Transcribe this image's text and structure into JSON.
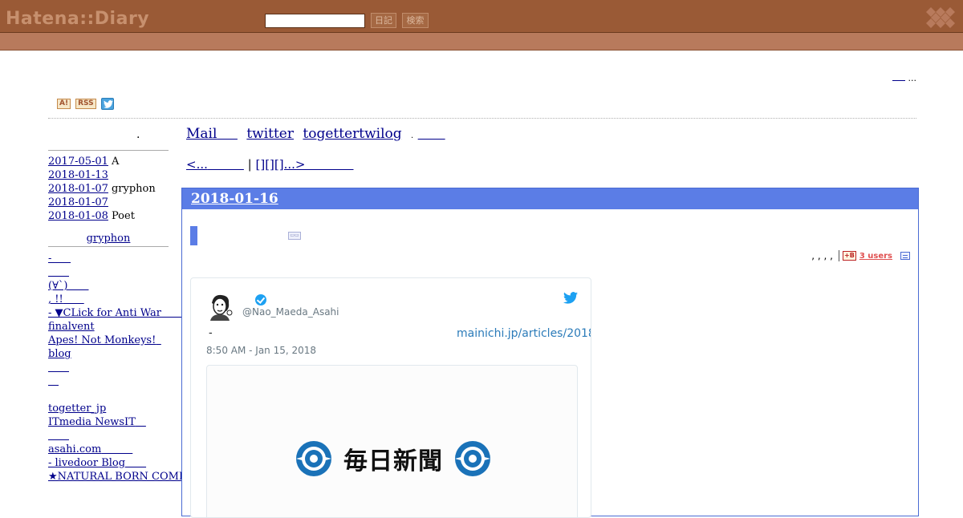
{
  "header": {
    "logo_text": "Hatena::Diary",
    "search_placeholder": "",
    "diary_button": "日記",
    "search_button": "検索"
  },
  "top_right": {
    "link": "",
    "dots": "..."
  },
  "badges": {
    "a": "A!",
    "rss": "RSS",
    "twitter": "twitter-icon"
  },
  "sidebar": {
    "dot": ".",
    "recent": [
      {
        "date": "2017-05-01",
        "text": "A"
      },
      {
        "date": "2018-01-13",
        "text": ""
      },
      {
        "date": "2018-01-07",
        "text": "gryphon"
      },
      {
        "date": "2018-01-07",
        "text": ""
      },
      {
        "date": "2018-01-08",
        "text": "Poet"
      }
    ],
    "title": "gryphon",
    "links": [
      "- ",
      "",
      "(∀`)",
      ", !!",
      " - ▼CLick for Anti War",
      "finalvent",
      "Apes! Not Monkeys!",
      "blog",
      "",
      "",
      "",
      "togetter_jp",
      "ITmedia NewsIT",
      "",
      "asahi.com",
      " - livedoor Blog",
      "★NATURAL BORN COMICS)"
    ]
  },
  "nav": {
    "mail": "Mail",
    "twitter": "twitter",
    "togetter": "togettertwilog",
    "dot": ".",
    "extra": ""
  },
  "pager": {
    "prev": "<...",
    "sep": "|",
    "next": "[][][]...>"
  },
  "day": {
    "date": "2018-01-16",
    "commas": ", , , ,",
    "hatebu_icon": "+B",
    "users": "3 users"
  },
  "tweet": {
    "handle": "@Nao_Maeda_Asahi",
    "dash": "-",
    "link": "mainichi.jp/articles/2018",
    "time": "8:50 AM - Jan 15, 2018",
    "media_title": "毎日新聞"
  },
  "colors": {
    "header_bg": "#9a5a36",
    "subheader_bg": "#b87a5c",
    "day_bar": "#5b7de6",
    "link": "#00008b",
    "tweet_link": "#2b7bb9"
  }
}
